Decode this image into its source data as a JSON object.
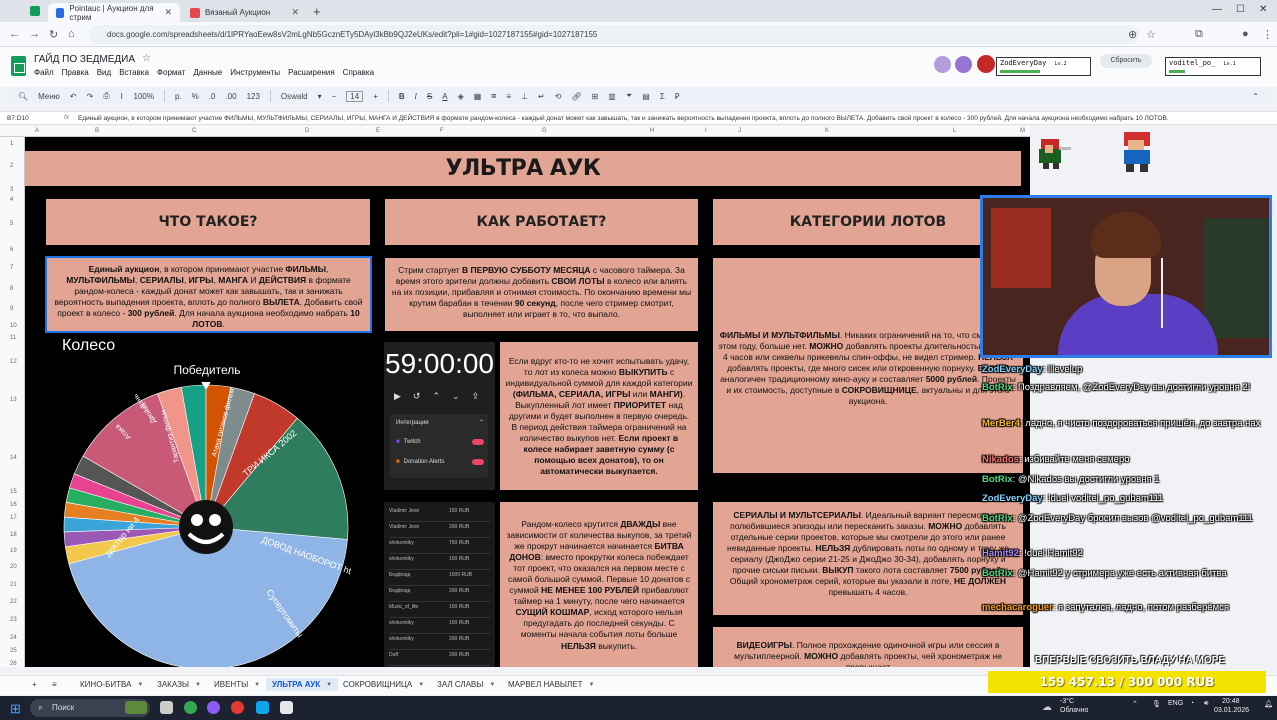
{
  "browser": {
    "tabs": [
      {
        "title": "Pointauc | Аукцион для стрим",
        "active": true
      },
      {
        "title": "Вязаный Аукцион",
        "active": false
      }
    ],
    "url": "docs.google.com/spreadsheets/d/1lPRYaoEew8sV2mLgNb5GcznETy5DAyl3kBb9QJ2eUKs/edit?pli=1#gid=1027187155#gid=1027187155"
  },
  "doc": {
    "title": "ГАЙД ПО ЗЕДМЕДИА",
    "menus": [
      "Файл",
      "Правка",
      "Вид",
      "Вставка",
      "Формат",
      "Данные",
      "Инструменты",
      "Расширения",
      "Справка"
    ]
  },
  "toolbar": {
    "menu_label": "Меню",
    "zoom": "100%",
    "currency": "р.",
    "percent": "%",
    "dec_less": ".0",
    "dec_more": ".00",
    "num_fmt": "123",
    "font": "Oswald",
    "font_size": "14"
  },
  "formula": {
    "cell_ref": "B7:D10",
    "fx": "fx",
    "text": "Единый аукцион, в котором принимают участие ФИЛЬМЫ, МУЛЬТФИЛЬМЫ, СЕРИАЛЫ, ИГРЫ, МАНГА И ДЕЙСТВИЯ в формате рандом-колеса - каждый донат может как завышать, так и занижать вероятность выпадения проекта, вплоть до полного ВЫЛЕТА. Добавить свой проект в колесо - 300 рублей. Для начала аукциона необходимо набрать 10 ЛОТОВ."
  },
  "columns": [
    "A",
    "B",
    "C",
    "D",
    "E",
    "F",
    "G",
    "H",
    "I",
    "J",
    "K",
    "L",
    "M"
  ],
  "rows": [
    "1",
    "2",
    "3",
    "4",
    "5",
    "6",
    "7",
    "8",
    "9",
    "10",
    "11",
    "12",
    "13",
    "14",
    "15",
    "16",
    "17",
    "18",
    "19",
    "20",
    "21",
    "22",
    "23",
    "24",
    "25",
    "26"
  ],
  "sheet": {
    "banner": "УЛЬТРА АУК",
    "headers": [
      "ЧТО ТАКОЕ?",
      "КАК РАБОТАЕТ?",
      "КАТЕГОРИИ ЛОТОВ"
    ],
    "what_is": {
      "p1": "Единый аукцион",
      "p2": ", в котором принимают участие ",
      "p3": "ФИЛЬМЫ",
      "p4": ", ",
      "p5": "МУЛЬТФИЛЬМЫ",
      "p6": ", ",
      "p7": "СЕРИАЛЫ",
      "p8": ", ",
      "p9": "ИГРЫ",
      "p10": ", ",
      "p11": "МАНГА",
      "p12": " И ",
      "p13": "ДЕЙСТВИЯ",
      "p14": " в формате рандом-колеса - каждый донат может как завышать, так и занижать вероятность выпадения проекта, вплоть до полного ",
      "p15": "ВЫЛЕТА",
      "p16": ". Добавить свой проект в колесо - ",
      "p17": "300 рублей",
      "p18": ". Для начала аукциона необходимо набрать ",
      "p19": "10 ЛОТОВ",
      "p20": "."
    },
    "how_1": {
      "p1": "Стрим стартует ",
      "p2": "В ПЕРВУЮ СУББОТУ МЕСЯЦА",
      "p3": " с часового таймера. За время этого зрители должны добавить ",
      "p4": "СВОИ ЛОТЫ",
      "p5": " в колесо или влиять на их позиции, прибавляя и отнимая стоимость. По окончанию времени мы крутим барабан в течении ",
      "p6": "90 секунд",
      "p7": ", после чего стример смотрит, выполняет или играет в то, что выпало."
    },
    "how_2": {
      "p1": "Если вдруг кто-то не хочет испытывать удачу, то лот из колеса можно ",
      "p2": "ВЫКУПИТЬ",
      "p3": " с индивидуальной суммой для каждой категории ",
      "p4": "(ФИЛЬМА, СЕРИАЛА, ИГРЫ",
      "p5": " или ",
      "p6": "МАНГИ)",
      "p7": ". Выкупленный лот имеет ",
      "p8": "ПРИОРИТЕТ",
      "p9": " над другими и будет выполнен в первую очередь. В период действия таймера ограничений на количество выкупов нет. ",
      "p10": "Если проект в колесе набирает заветную сумму (с помощью всех донатов), то он автоматически выкупается."
    },
    "how_3": {
      "p1": "Рандом-колесо крутится ",
      "p2": "ДВАЖДЫ",
      "p3": " вне зависимости от количества выкупов, за третий же прокрут начинается начинается ",
      "p4": "БИТВА ДОНОВ",
      "p5": ": вместо прокрутки колеса побеждает тот проект, что оказался на первом месте с самой большой суммой. Первые 10 донатов с суммой ",
      "p6": "НЕ МЕНЕЕ 100 РУБЛЕЙ",
      "p7": " прибавляют таймер на 1 минуту, после чего начинается ",
      "p8": "СУЩИЙ КОШМАР",
      "p9": ", исход которого нельзя предугадать до последней секунды. С моменты начала события лоты больше ",
      "p10": "НЕЛЬЗЯ",
      "p11": " выкупить."
    },
    "cat_1": {
      "p1": "ФИЛЬМЫ И МУЛЬТФИЛЬМЫ",
      "p2": ". Никаких ограничений на то, что смотрели в этом году, больше нет. ",
      "p3": "МОЖНО",
      "p4": " добавлять проекты длительностью больше 4 часов или сиквелы прикевелы спин-оффы, не видел стример. ",
      "p5": "НЕЛЬЗЯ",
      "p6": " добавлять проекты, где много сисек или откровенную порнуху. ",
      "p7": "ВЫКУП",
      "p8": " аналогичен традиционному кино-ауку и составляет ",
      "p9": "5000 рублей",
      "p10": ". Проекты и их стоимость, доступные в ",
      "p11": "СОКРОВИЩНИЦЕ",
      "p12": ", актуальны и для этого аукциона."
    },
    "cat_2": {
      "p1": "СЕРИАЛЫ И МУЛЬТСЕРИАЛЫ",
      "p2": ". Идеальный вариант пересмотреть полюбившиеся эпизоды или пересканить заказы. ",
      "p3": "МОЖНО",
      "p4": " добавлять отдельные серии проектов, которые мы смотрели до этого или ранее невиданные проекты. ",
      "p5": "НЕЛЬЗЯ",
      "p6": " дублировать лоты по одному и тому же сериалу (ДжоДжо серии 21-25 и ДжоДжо 30-34), добавлять порнуху и прочие сиськи письки. ",
      "p7": "ВЫКУП",
      "p8": " такого лота составляет ",
      "p9": "7500 рублей",
      "p10": ". Общий хронометраж серий, которые вы указали в лоте, ",
      "p11": "НЕ ДОЛЖЕН",
      "p12": " превышать 4 часов."
    },
    "cat_3": {
      "p1": "ВИДЕОИГРЫ",
      "p2": ". Полное прохождение одиночной игры или сессия в мультиплеерной. ",
      "p3": "МОЖНО",
      "p4": " добавлять проекты, чей хронометраж не превышает"
    },
    "wheel": {
      "title": "Колесо",
      "winner": "Победитель",
      "labels": [
        "ДОВОД НАОБОРОТ https:...",
        "ТРИ ИКСА 2002",
        "Супертомиты",
        "Атака титанов фильм",
        "Тарантиз-фильм",
        "Двойка",
        "Фэнь",
        "Атака",
        "доктор ни 4"
      ],
      "colors": [
        "#8fb4e6",
        "#2e7d5e",
        "#c85a78",
        "#f2c94c",
        "#9b59b6",
        "#3ba4d8",
        "#e67e22",
        "#27ae60",
        "#e84393",
        "#555555",
        "#f1948a",
        "#16a085",
        "#d35400",
        "#7f8c8d",
        "#c0392b"
      ]
    },
    "timer": {
      "digits": "59:00:00",
      "integrations_label": "Интеграции",
      "items": [
        "Twitch",
        "Donation Alerts"
      ]
    },
    "donations": {
      "rows": [
        {
          "name": "Vladimir Jeon",
          "amount": "150 RUB"
        },
        {
          "name": "Vladimir Jeon",
          "amount": "200 RUB"
        },
        {
          "name": "shokomilky",
          "amount": "750 RUB"
        },
        {
          "name": "shokomilky",
          "amount": "100 RUB"
        },
        {
          "name": "Бедфорд",
          "amount": "1000 RUB"
        },
        {
          "name": "Бедфорд",
          "amount": "200 RUB"
        },
        {
          "name": "Music_of_life",
          "amount": "100 RUB"
        },
        {
          "name": "shokomilky",
          "amount": "100 RUB"
        },
        {
          "name": "shokomilky",
          "amount": "200 RUB"
        },
        {
          "name": "Duff",
          "amount": "200 RUB"
        }
      ]
    }
  },
  "sheet_tabs": [
    "КИНО-БИТВА",
    "ЗАКАЗЫ",
    "ИВЕНТЫ",
    "УЛЬТРА АУК",
    "СОКРОВИЩНИЦА",
    "ЗАЛ СЛАВЫ",
    "МАРВЕЛ НАВЫЛЕТ"
  ],
  "active_sheet_tab": "УЛЬТРА АУК",
  "overlay": {
    "players": [
      {
        "name": "ZodEveryDay",
        "level": "Lv.2"
      },
      {
        "name": "voditel_po_",
        "level": "Lv.1"
      }
    ],
    "reset_label": "Сбросить",
    "chat": [
      {
        "user": "ZodEveryDay",
        "user_color": "#7dd3fc",
        "text": ": lilevelup"
      },
      {
        "user": "BotRix",
        "user_color": "#4ade80",
        "text": ": Поздравляем, @ZodEveryDay вы достигли уровня 2!"
      },
      {
        "user": "MerBer4",
        "user_color": "#fbbf24",
        "text": ": ладно, я чисто поздороваться пришёл, до завтра нах"
      },
      {
        "user": "Nikados",
        "user_color": "#f87171",
        "text": ": избивайте меня семеро"
      },
      {
        "user": "BotRix",
        "user_color": "#4ade80",
        "text": ": @Nikados вы достигли уровня 1"
      },
      {
        "user": "ZodEveryDay",
        "user_color": "#7dd3fc",
        "text": ": !duel voditel_po_gubam111"
      },
      {
        "user": "BotRix",
        "user_color": "#4ade80",
        "text": ": @ZodEveryDay бросил вызов @voditel_po_gubam111"
      },
      {
        "user": "Hamit92",
        "user_color": "#a78bfa",
        "text": ": !duel Hamit92"
      },
      {
        "user": "BotRix",
        "user_color": "#4ade80",
        "text": ": @Hamit92 у стримера уже есть активная битва"
      },
      {
        "user": "mechacaroguer",
        "user_color": "#f59e0b",
        "text": ": я запутался, ладно, потом разберёмся"
      }
    ],
    "goal_caption": "ВПЕРВЫЕ СВОЗИТЬ ВЛАДУ НА МОРЕ",
    "goal_text": "159 457.13 / 300 000 RUB",
    "goal_progress": 0.53
  },
  "taskbar": {
    "search": "Поиск",
    "weather": "-3°C",
    "weather_desc": "Облачно",
    "lang": "ENG",
    "time": "20:48",
    "date": "03.01.2026"
  }
}
